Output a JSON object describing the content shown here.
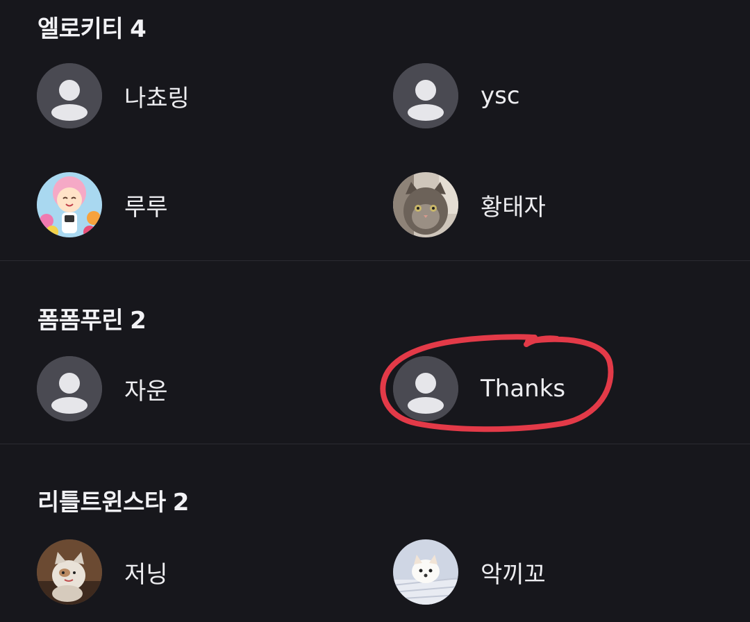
{
  "groups": [
    {
      "name": "엘로키티",
      "count": "4",
      "members": [
        {
          "name": "나쵸링",
          "avatar": "default-profile-icon"
        },
        {
          "name": "ysc",
          "avatar": "default-profile-icon"
        },
        {
          "name": "루루",
          "avatar": "character-photo"
        },
        {
          "name": "황태자",
          "avatar": "cat-photo"
        }
      ]
    },
    {
      "name": "폼폼푸린",
      "count": "2",
      "members": [
        {
          "name": "자운",
          "avatar": "default-profile-icon"
        },
        {
          "name": "Thanks",
          "avatar": "default-profile-icon"
        }
      ]
    },
    {
      "name": "리틀트윈스타",
      "count": "2",
      "members": [
        {
          "name": "저닝",
          "avatar": "cat-photo"
        },
        {
          "name": "악끼꼬",
          "avatar": "dog-photo"
        }
      ]
    }
  ],
  "colors": {
    "background": "#17171c",
    "default_avatar_bg": "#4a4a52",
    "default_avatar_fg": "#e6e6ea",
    "annotation": "#e33a48"
  }
}
